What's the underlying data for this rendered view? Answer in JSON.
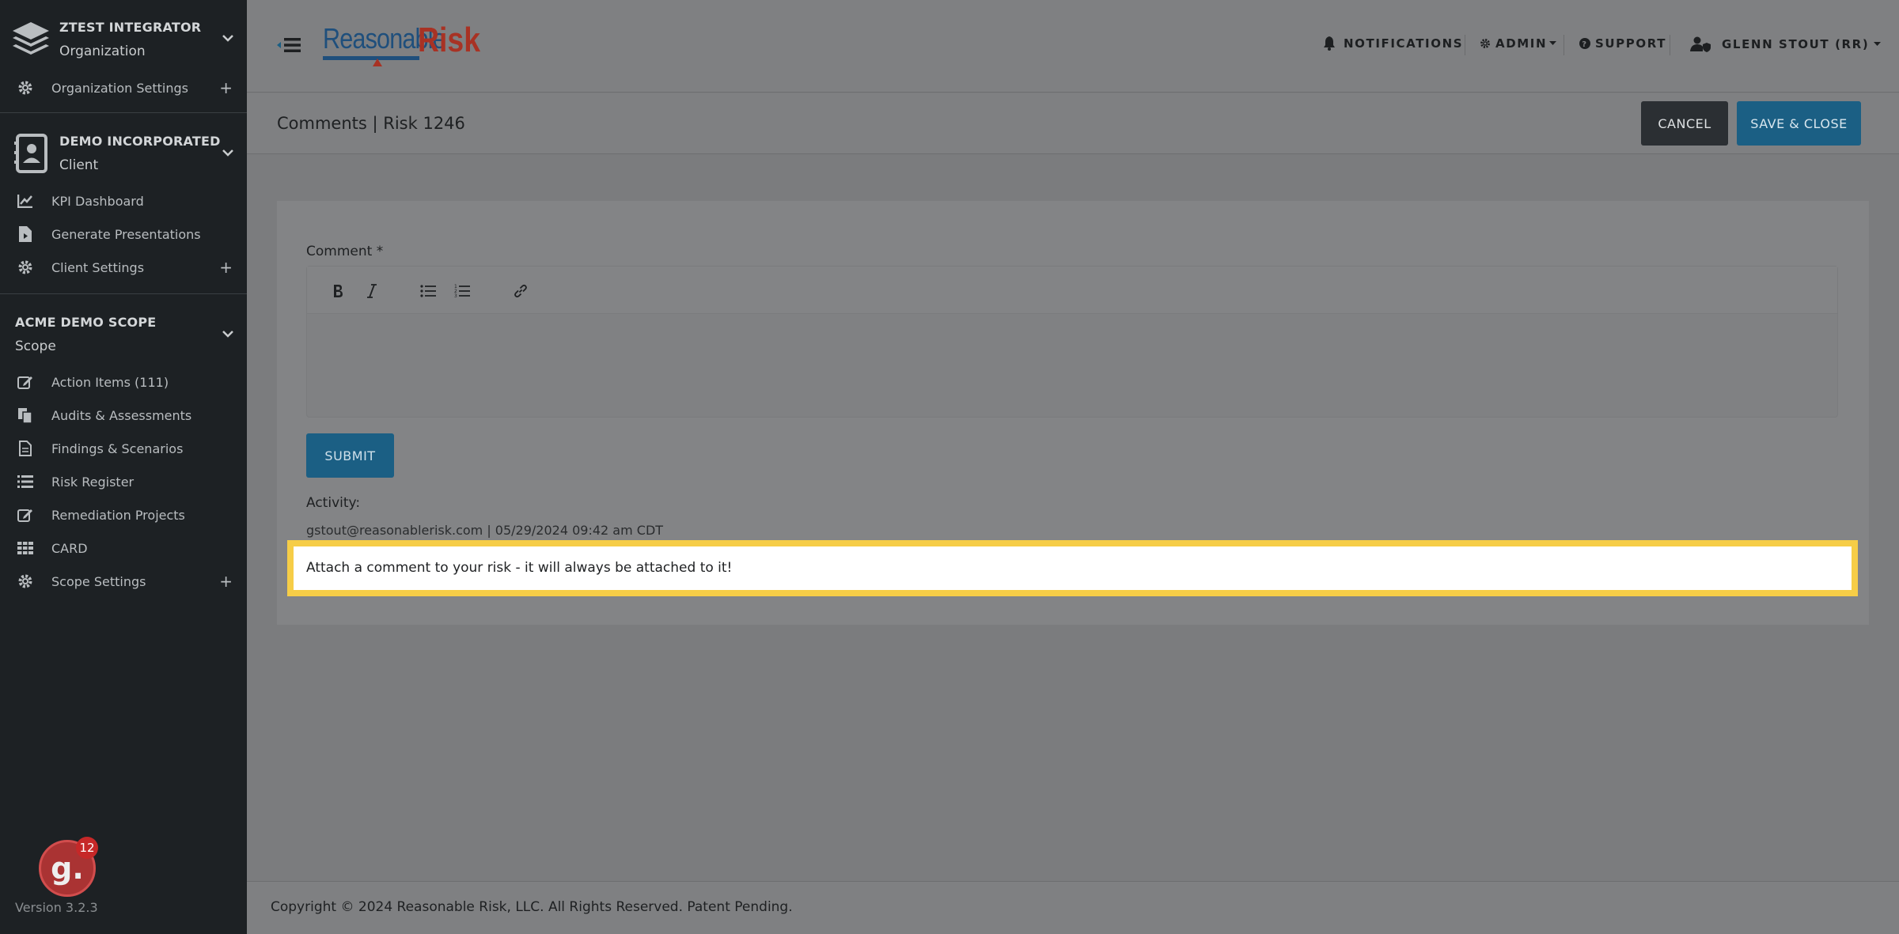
{
  "sidebar": {
    "org": {
      "name": "ZTEST INTEGRATOR",
      "type": "Organization",
      "settings_label": "Organization Settings"
    },
    "client": {
      "name": "DEMO INCORPORATED",
      "type": "Client",
      "items": [
        {
          "label": "KPI Dashboard",
          "icon": "chart-line-icon"
        },
        {
          "label": "Generate Presentations",
          "icon": "file-presentation-icon"
        },
        {
          "label": "Client Settings",
          "icon": "gear-icon"
        }
      ]
    },
    "scope": {
      "name": "ACME DEMO SCOPE",
      "type": "Scope",
      "items": [
        {
          "label": "Action Items (111)",
          "icon": "edit-icon"
        },
        {
          "label": "Audits & Assessments",
          "icon": "copy-icon"
        },
        {
          "label": "Findings & Scenarios",
          "icon": "file-icon"
        },
        {
          "label": "Risk Register",
          "icon": "list-icon"
        },
        {
          "label": "Remediation Projects",
          "icon": "edit-icon"
        },
        {
          "label": "CARD",
          "icon": "grid-icon"
        },
        {
          "label": "Scope Settings",
          "icon": "gear-icon"
        }
      ]
    },
    "badge_letter": "g.",
    "badge_count": "12",
    "version": "Version 3.2.3"
  },
  "header": {
    "logo_part1": "Reasonable",
    "logo_part2": "Risk",
    "nav": {
      "notifications": "NOTIFICATIONS",
      "admin": "ADMIN",
      "support": "SUPPORT",
      "user": "GLENN STOUT (RR)"
    }
  },
  "page": {
    "title": "Comments | Risk 1246",
    "cancel_label": "CANCEL",
    "save_label": "SAVE & CLOSE"
  },
  "form": {
    "comment_label": "Comment *",
    "submit_label": "SUBMIT",
    "activity_label": "Activity:",
    "activity_meta": "gstout@reasonablerisk.com | 05/29/2024 09:42 am CDT",
    "highlight_text": "Attach a comment to your risk - it will always be attached to it!"
  },
  "footer": {
    "copyright": "Copyright © 2024 Reasonable Risk, LLC. All Rights Reserved. Patent Pending."
  },
  "colors": {
    "sidebar_bg": "#1d2124",
    "primary": "#1b5f84",
    "highlight_border": "#f6cd47"
  }
}
